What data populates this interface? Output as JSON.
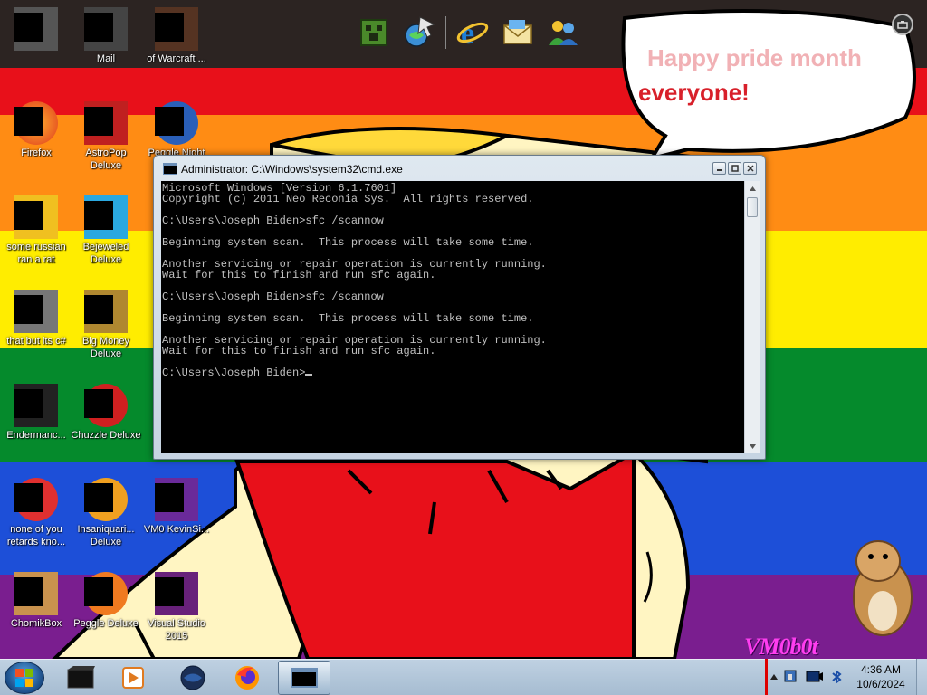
{
  "wallpaper": {
    "bubble_line1": "Happy pride month",
    "bubble_line2": "everyone!",
    "signature": "VM0b0t"
  },
  "desktop_icons": [
    {
      "id": "top-1",
      "label": ""
    },
    {
      "id": "top-mail",
      "label": "Mail"
    },
    {
      "id": "top-warcraft",
      "label": "of Warcraft ..."
    },
    {
      "id": "firefox",
      "label": "Firefox"
    },
    {
      "id": "astropop",
      "label": "AstroPop Deluxe"
    },
    {
      "id": "peggle-nights",
      "label": "Peggle Night"
    },
    {
      "id": "russian-rat",
      "label": "some russian ran a rat"
    },
    {
      "id": "bejeweled",
      "label": "Bejeweled Deluxe"
    },
    {
      "id": "that-but-c",
      "label": "that but its c#"
    },
    {
      "id": "big-money",
      "label": "Big Money Deluxe"
    },
    {
      "id": "endermanc",
      "label": "Endermanc..."
    },
    {
      "id": "chuzzle",
      "label": "Chuzzle Deluxe"
    },
    {
      "id": "none-of-you",
      "label": "none of you retards kno..."
    },
    {
      "id": "insaniquarium",
      "label": "Insaniquari... Deluxe"
    },
    {
      "id": "vm0-kevin",
      "label": "VM0 KevinSi..."
    },
    {
      "id": "chomikbox",
      "label": "ChomikBox"
    },
    {
      "id": "peggle-deluxe",
      "label": "Peggle Deluxe"
    },
    {
      "id": "visual-studio",
      "label": "Visual Studio 2015"
    }
  ],
  "cmd": {
    "title": "Administrator: C:\\Windows\\system32\\cmd.exe",
    "lines": [
      "Microsoft Windows [Version 6.1.7601]",
      "Copyright (c) 2011 Neo Reconia Sys.  All rights reserved.",
      "",
      "C:\\Users\\Joseph Biden>sfc /scannow",
      "",
      "Beginning system scan.  This process will take some time.",
      "",
      "Another servicing or repair operation is currently running.",
      "Wait for this to finish and run sfc again.",
      "",
      "C:\\Users\\Joseph Biden>sfc /scannow",
      "",
      "Beginning system scan.  This process will take some time.",
      "",
      "Another servicing or repair operation is currently running.",
      "Wait for this to finish and run sfc again.",
      "",
      "C:\\Users\\Joseph Biden>"
    ]
  },
  "dock": [
    "minecraft-icon",
    "cursor-globe-icon",
    "internet-explorer-icon",
    "mail-icon",
    "messenger-icon"
  ],
  "taskbar": {
    "pinned": [
      "terminal-icon",
      "media-player-icon",
      "globe-icon",
      "firefox-icon",
      "cmd-icon"
    ],
    "clock_time": "4:36 AM",
    "clock_date": "10/6/2024"
  }
}
